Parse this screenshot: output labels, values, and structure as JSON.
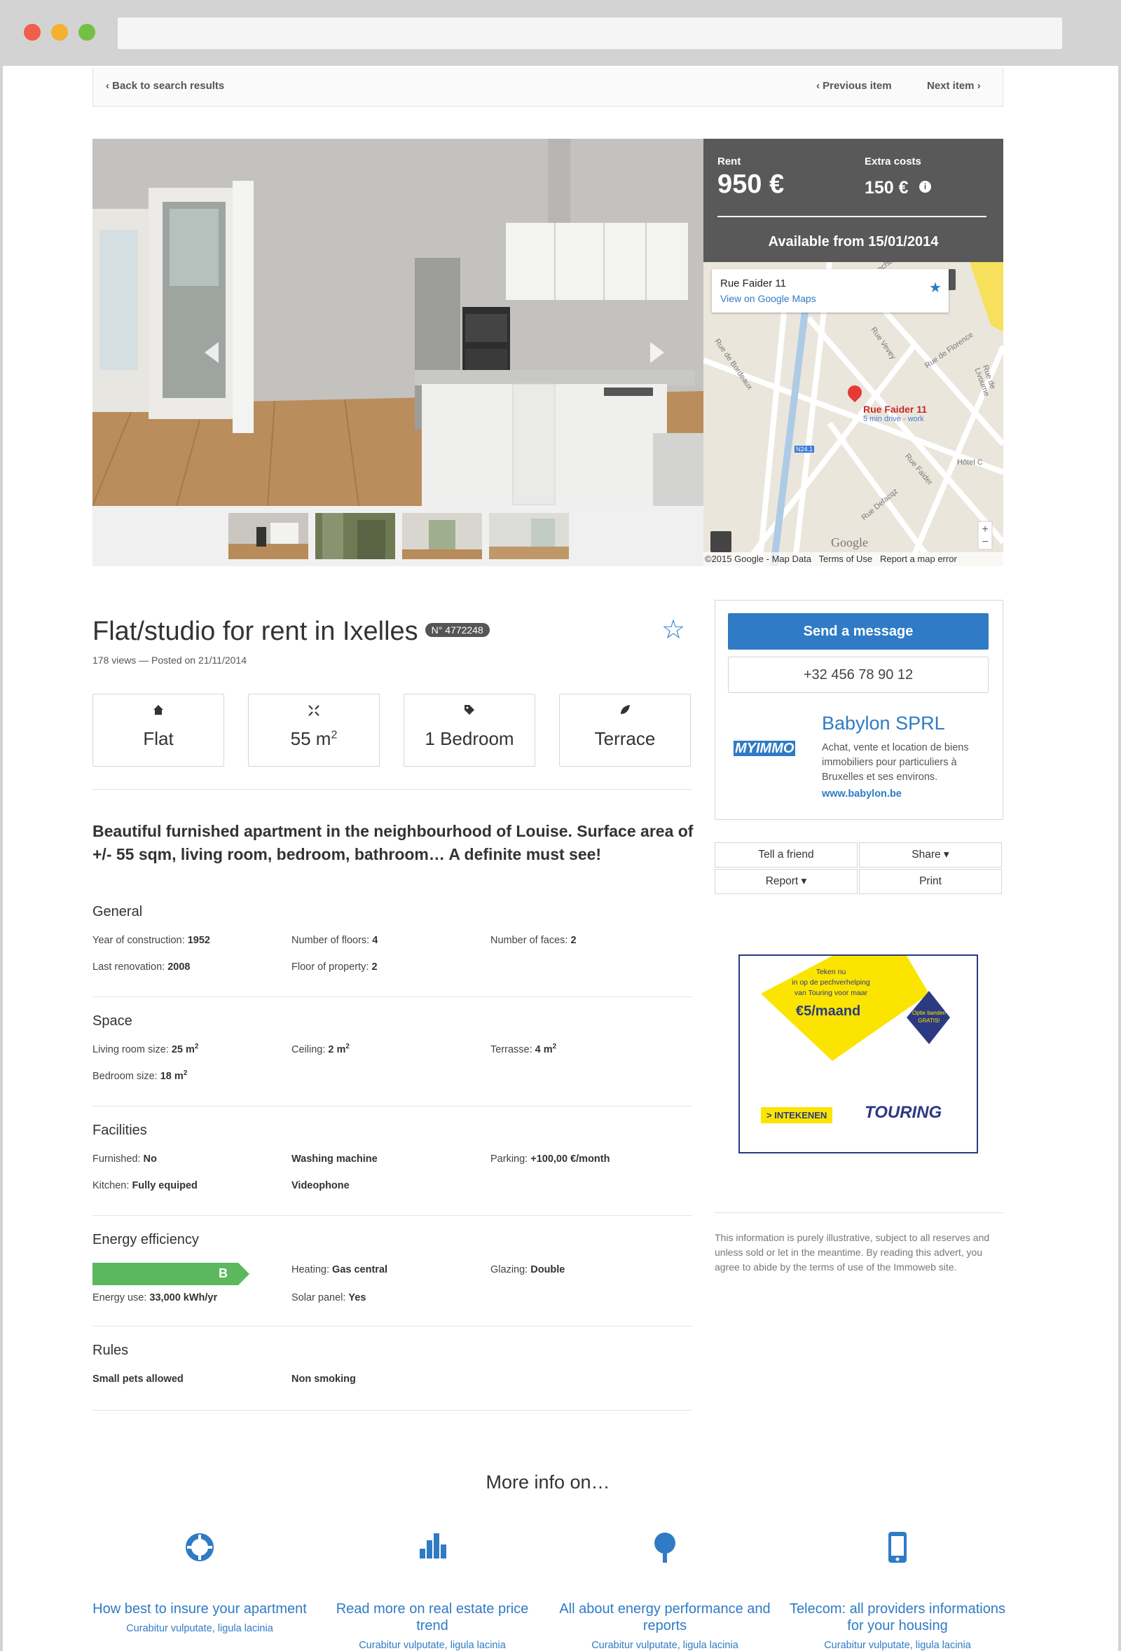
{
  "nav": {
    "back": "Back to search results",
    "previous": "Previous item",
    "next": "Next item"
  },
  "price": {
    "rent_label": "Rent",
    "rent": "950 €",
    "extra_label": "Extra costs",
    "extra": "150 €",
    "available": "Available from 15/01/2014"
  },
  "map": {
    "info_title": "Rue Faider 11",
    "info_link": "View on Google Maps",
    "pin_label": "Rue Faider 11",
    "pin_sub": "5 min drive - work",
    "streets": [
      "Rue Blanche",
      "Rue Vevey",
      "Rue de Florence",
      "Rue de Livourne",
      "Rue Faider",
      "Rue Defacqz",
      "Rue de Bordeaux",
      "Hôtel C",
      "N24.1"
    ],
    "logo": "Google",
    "footer": "©2015 Google - Map Data   Terms of Use   Report a map error"
  },
  "listing": {
    "title": "Flat/studio for rent in Ixelles",
    "ref": "N° 4772248",
    "meta": "178 views — Posted on 21/11/2014",
    "features": [
      {
        "icon": "home-icon",
        "label": "Flat"
      },
      {
        "icon": "expand-icon",
        "label": "55 m",
        "sup": "2"
      },
      {
        "icon": "tag-icon",
        "label": "1 Bedroom"
      },
      {
        "icon": "leaf-icon",
        "label": "Terrace"
      }
    ],
    "lead": "Beautiful furnished apartment in the neighbourhood of Louise. Surface area of +/- 55 sqm, living room, bedroom, bathroom… A definite must see!"
  },
  "sections": {
    "general": {
      "title": "General",
      "year_k": "Year of construction:",
      "year_v": "1952",
      "floors_k": "Number of floors:",
      "floors_v": "4",
      "faces_k": "Number of faces:",
      "faces_v": "2",
      "renov_k": "Last renovation:",
      "renov_v": "2008",
      "floorprop_k": "Floor of property:",
      "floorprop_v": "2"
    },
    "space": {
      "title": "Space",
      "living_k": "Living room size:",
      "living_v": "25 m",
      "ceiling_k": "Ceiling:",
      "ceiling_v": "2 m",
      "terrasse_k": "Terrasse:",
      "terrasse_v": "4 m",
      "bedroom_k": "Bedroom size:",
      "bedroom_v": "18 m",
      "sup": "2"
    },
    "facilities": {
      "title": "Facilities",
      "furnished_k": "Furnished:",
      "furnished_v": "No",
      "washing": "Washing machine",
      "parking_k": "Parking:",
      "parking_v": "+100,00 €/month",
      "kitchen_k": "Kitchen:",
      "kitchen_v": "Fully equiped",
      "videophone": "Videophone"
    },
    "energy": {
      "title": "Energy efficiency",
      "class": "B",
      "use_k": "Energy use:",
      "use_v": "33,000 kWh/yr",
      "heating_k": "Heating:",
      "heating_v": "Gas central",
      "glazing_k": "Glazing:",
      "glazing_v": "Double",
      "solar_k": "Solar panel:",
      "solar_v": "Yes"
    },
    "rules": {
      "title": "Rules",
      "pets": "Small pets allowed",
      "smoking": "Non smoking"
    }
  },
  "contact": {
    "send": "Send a message",
    "phone": "+32 456 78 90 12",
    "logo_text": "MYIMMO",
    "agency": "Babylon SPRL",
    "desc": "Achat, vente et location de biens immobiliers pour particuliers à Bruxelles et ses environs.",
    "url": "www.babylon.be"
  },
  "actions": {
    "tell": "Tell a friend",
    "share": "Share ▾",
    "report": "Report ▾",
    "print": "Print"
  },
  "ad": {
    "line1": "Teken nu",
    "line2": "in op de pechverhelping",
    "line3": "van Touring voor maar",
    "price": "€5/maand",
    "badge1": "Optie banden",
    "badge2": "GRATIS!",
    "cta": "> INTEKENEN",
    "brand": "TOURING"
  },
  "disclaimer": "This information is purely illustrative, subject to all reserves and unless sold or let in the meantime. By reading this advert, you agree to abide by the terms of use of the Immoweb site.",
  "more": {
    "title": "More info on…",
    "items": [
      {
        "icon": "lifebuoy-icon",
        "title": "How best to insure your apartment",
        "sub": "Curabitur vulputate, ligula lacinia"
      },
      {
        "icon": "bar-chart-icon",
        "title": "Read more on real estate price trend",
        "sub": "Curabitur vulputate, ligula lacinia"
      },
      {
        "icon": "tree-icon",
        "title": "All about energy performance and reports",
        "sub": "Curabitur vulputate, ligula lacinia"
      },
      {
        "icon": "mobile-icon",
        "title": "Telecom: all providers informations for your housing",
        "sub": "Curabitur vulputate, ligula lacinia"
      }
    ]
  },
  "colors": {
    "accent": "#2f7bc5",
    "energy_b": "#5cb85c",
    "price_bg": "#595959"
  }
}
